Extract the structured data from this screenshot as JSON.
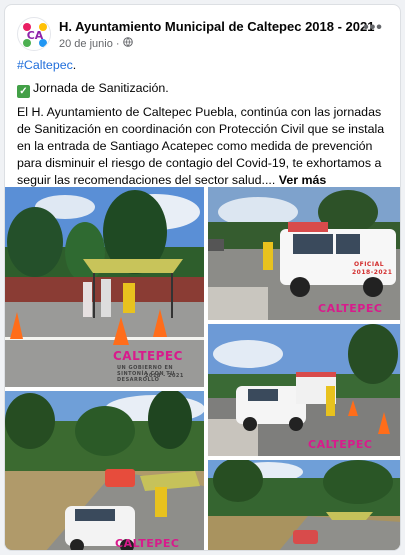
{
  "post": {
    "author": "H. Ayuntamiento Municipal de Caltepec 2018 - 2021",
    "date": "20 de junio",
    "separator": "·",
    "avatar_text": "CA",
    "hashtag": "#Caltepec",
    "hashtag_suffix": ".",
    "headline": "Jornada de Sanitización.",
    "body": "El H. Ayuntamiento de Caltepec Puebla, continúa con las jornadas de Sanitización en coordinación con Protección Civil que se instala en la entrada de Santiago Acatepec como medida de prevención para disminuir el riesgo de contagio del Covid-19, te exhortamos a seguir las recomendaciones del sector salud....",
    "see_more": "Ver más",
    "more_options": "•••"
  },
  "photos": {
    "watermark": "CALTEPEC",
    "watermark_sub": "UN GOBIERNO EN SINTONÍA CON TU DESARROLLO",
    "watermark_years": "2018 - 2021",
    "truck_text_1": "OFICIAL",
    "truck_text_2": "2018-2021"
  },
  "colors": {
    "link": "#216fdb",
    "muted": "#65676b",
    "check": "#43a047"
  }
}
